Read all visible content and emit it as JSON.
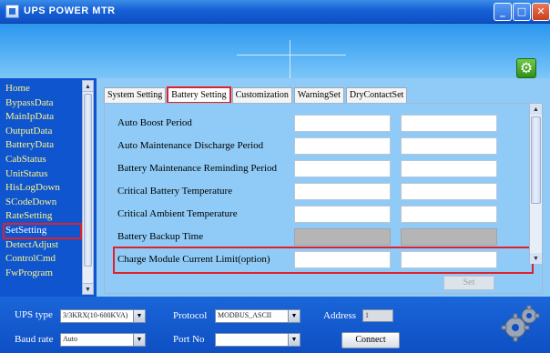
{
  "window": {
    "title": "UPS POWER MTR",
    "minimize_glyph": "_",
    "maximize_glyph": "□",
    "close_glyph": "✕",
    "settings_glyph": "⚙"
  },
  "sidebar": {
    "items": [
      {
        "label": "Home"
      },
      {
        "label": "BypassData"
      },
      {
        "label": "MainIpData"
      },
      {
        "label": "OutputData"
      },
      {
        "label": "BatteryData"
      },
      {
        "label": "CabStatus"
      },
      {
        "label": "UnitStatus"
      },
      {
        "label": "HisLogDown"
      },
      {
        "label": "SCodeDown"
      },
      {
        "label": "RateSetting"
      },
      {
        "label": "SetSetting",
        "selected": true
      },
      {
        "label": "DetectAdjust"
      },
      {
        "label": "ControlCmd"
      },
      {
        "label": "FwProgram"
      }
    ]
  },
  "tabs": [
    {
      "label": "System Setting"
    },
    {
      "label": "Battery Setting",
      "selected": true
    },
    {
      "label": "Customization"
    },
    {
      "label": "WarningSet"
    },
    {
      "label": "DryContactSet"
    }
  ],
  "battery_settings": {
    "rows": [
      {
        "label": "Auto Boost Period",
        "value1": "",
        "value2": ""
      },
      {
        "label": "Auto Maintenance Discharge Period",
        "value1": "",
        "value2": ""
      },
      {
        "label": "Battery Maintenance Reminding Period",
        "value1": "",
        "value2": ""
      },
      {
        "label": "Critical Battery Temperature",
        "value1": "",
        "value2": ""
      },
      {
        "label": "Critical Ambient Temperature",
        "value1": "",
        "value2": ""
      },
      {
        "label": "Battery Backup Time",
        "value1": "",
        "value2": "",
        "disabled": true
      },
      {
        "label": "Charge Module Current Limit(option)",
        "value1": "",
        "value2": "",
        "highlighted": true
      }
    ],
    "set_label": "Set"
  },
  "connection": {
    "ups_type_label": "UPS type",
    "ups_type_value": "3/3KRX(10-600KVA)",
    "protocol_label": "Protocol",
    "protocol_value": "MODBUS_ASCII",
    "address_label": "Address",
    "address_value": "1",
    "baud_rate_label": "Baud rate",
    "baud_rate_value": "Auto",
    "port_no_label": "Port No",
    "port_no_value": "",
    "connect_label": "Connect"
  },
  "colors": {
    "window_blue": "#0f55cf",
    "content_bg": "#8fcbf6",
    "nav_text": "#fdf58a",
    "highlight_red": "#e0202a"
  }
}
